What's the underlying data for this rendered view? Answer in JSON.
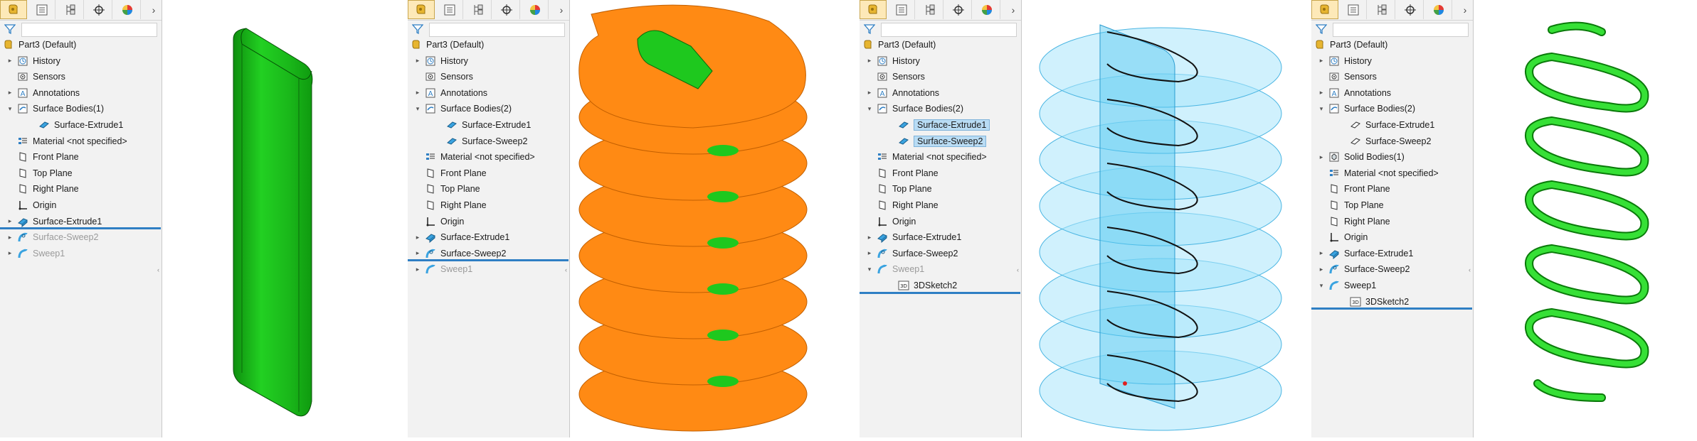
{
  "toolbar_tabs": [
    "feature-manager-tab",
    "property-manager-tab",
    "configuration-manager-tab",
    "dimxpert-manager-tab",
    "display-manager-tab"
  ],
  "panels": [
    {
      "root": "Part3  (Default)",
      "items": [
        {
          "label": "History",
          "icon": "history-icon",
          "expand": "collapsed"
        },
        {
          "label": "Sensors",
          "icon": "sensors-icon",
          "expand": "none"
        },
        {
          "label": "Annotations",
          "icon": "annotations-icon",
          "expand": "collapsed"
        },
        {
          "label": "Surface Bodies(1)",
          "icon": "surface-bodies-icon",
          "expand": "expanded"
        },
        {
          "label": "Surface-Extrude1",
          "icon": "surface-body-icon",
          "expand": "none",
          "child": true
        },
        {
          "label": "Material <not specified>",
          "icon": "material-icon",
          "expand": "none"
        },
        {
          "label": "Front Plane",
          "icon": "plane-icon",
          "expand": "none"
        },
        {
          "label": "Top Plane",
          "icon": "plane-icon",
          "expand": "none"
        },
        {
          "label": "Right Plane",
          "icon": "plane-icon",
          "expand": "none"
        },
        {
          "label": "Origin",
          "icon": "origin-icon",
          "expand": "none"
        },
        {
          "label": "Surface-Extrude1",
          "icon": "surface-extrude-icon",
          "expand": "collapsed"
        },
        {
          "label": "Surface-Sweep2",
          "icon": "surface-sweep-icon",
          "expand": "collapsed",
          "suppressed": true
        },
        {
          "label": "Sweep1",
          "icon": "sweep-icon",
          "expand": "collapsed",
          "suppressed": true
        }
      ]
    },
    {
      "root": "Part3  (Default)",
      "items": [
        {
          "label": "History",
          "icon": "history-icon",
          "expand": "collapsed"
        },
        {
          "label": "Sensors",
          "icon": "sensors-icon",
          "expand": "none"
        },
        {
          "label": "Annotations",
          "icon": "annotations-icon",
          "expand": "collapsed"
        },
        {
          "label": "Surface Bodies(2)",
          "icon": "surface-bodies-icon",
          "expand": "expanded"
        },
        {
          "label": "Surface-Extrude1",
          "icon": "surface-body-icon",
          "expand": "none",
          "child": true
        },
        {
          "label": "Surface-Sweep2",
          "icon": "surface-body-icon",
          "expand": "none",
          "child": true
        },
        {
          "label": "Material <not specified>",
          "icon": "material-icon",
          "expand": "none"
        },
        {
          "label": "Front Plane",
          "icon": "plane-icon",
          "expand": "none"
        },
        {
          "label": "Top Plane",
          "icon": "plane-icon",
          "expand": "none"
        },
        {
          "label": "Right Plane",
          "icon": "plane-icon",
          "expand": "none"
        },
        {
          "label": "Origin",
          "icon": "origin-icon",
          "expand": "none"
        },
        {
          "label": "Surface-Extrude1",
          "icon": "surface-extrude-icon",
          "expand": "collapsed"
        },
        {
          "label": "Surface-Sweep2",
          "icon": "surface-sweep-icon",
          "expand": "collapsed"
        },
        {
          "label": "Sweep1",
          "icon": "sweep-icon",
          "expand": "collapsed",
          "suppressed": true
        }
      ]
    },
    {
      "root": "Part3  (Default)",
      "items": [
        {
          "label": "History",
          "icon": "history-icon",
          "expand": "collapsed"
        },
        {
          "label": "Sensors",
          "icon": "sensors-icon",
          "expand": "none"
        },
        {
          "label": "Annotations",
          "icon": "annotations-icon",
          "expand": "collapsed"
        },
        {
          "label": "Surface Bodies(2)",
          "icon": "surface-bodies-icon",
          "expand": "expanded"
        },
        {
          "label": "Surface-Extrude1",
          "icon": "surface-body-icon",
          "expand": "none",
          "child": true,
          "selected": true
        },
        {
          "label": "Surface-Sweep2",
          "icon": "surface-body-icon",
          "expand": "none",
          "child": true,
          "selected": true
        },
        {
          "label": "Material <not specified>",
          "icon": "material-icon",
          "expand": "none"
        },
        {
          "label": "Front Plane",
          "icon": "plane-icon",
          "expand": "none"
        },
        {
          "label": "Top Plane",
          "icon": "plane-icon",
          "expand": "none"
        },
        {
          "label": "Right Plane",
          "icon": "plane-icon",
          "expand": "none"
        },
        {
          "label": "Origin",
          "icon": "origin-icon",
          "expand": "none"
        },
        {
          "label": "Surface-Extrude1",
          "icon": "surface-extrude-icon",
          "expand": "collapsed"
        },
        {
          "label": "Surface-Sweep2",
          "icon": "surface-sweep-icon",
          "expand": "collapsed"
        },
        {
          "label": "Sweep1",
          "icon": "sweep-icon",
          "expand": "expanded",
          "suppressed": true
        },
        {
          "label": "3DSketch2",
          "icon": "sketch3d-icon",
          "expand": "none",
          "child": true
        }
      ]
    },
    {
      "root": "Part3  (Default)",
      "items": [
        {
          "label": "History",
          "icon": "history-icon",
          "expand": "collapsed"
        },
        {
          "label": "Sensors",
          "icon": "sensors-icon",
          "expand": "none"
        },
        {
          "label": "Annotations",
          "icon": "annotations-icon",
          "expand": "collapsed"
        },
        {
          "label": "Surface Bodies(2)",
          "icon": "surface-bodies-icon",
          "expand": "expanded"
        },
        {
          "label": "Surface-Extrude1",
          "icon": "surface-body-outline-icon",
          "expand": "none",
          "child": true
        },
        {
          "label": "Surface-Sweep2",
          "icon": "surface-body-outline-icon",
          "expand": "none",
          "child": true
        },
        {
          "label": "Solid Bodies(1)",
          "icon": "solid-bodies-icon",
          "expand": "collapsed"
        },
        {
          "label": "Material <not specified>",
          "icon": "material-icon",
          "expand": "none"
        },
        {
          "label": "Front Plane",
          "icon": "plane-icon",
          "expand": "none"
        },
        {
          "label": "Top Plane",
          "icon": "plane-icon",
          "expand": "none"
        },
        {
          "label": "Right Plane",
          "icon": "plane-icon",
          "expand": "none"
        },
        {
          "label": "Origin",
          "icon": "origin-icon",
          "expand": "none"
        },
        {
          "label": "Surface-Extrude1",
          "icon": "surface-extrude-icon",
          "expand": "collapsed"
        },
        {
          "label": "Surface-Sweep2",
          "icon": "surface-sweep-icon",
          "expand": "collapsed"
        },
        {
          "label": "Sweep1",
          "icon": "sweep-icon",
          "expand": "expanded"
        },
        {
          "label": "3DSketch2",
          "icon": "sketch3d-icon",
          "expand": "none",
          "child": true
        }
      ]
    }
  ],
  "colors": {
    "extrude_green": "#1ec81e",
    "sweep_orange": "#ff8a14",
    "transparent_blue": "#7fd4f5",
    "rollback_bar": "#2f7fc4",
    "selection": "#b9dcf4"
  }
}
